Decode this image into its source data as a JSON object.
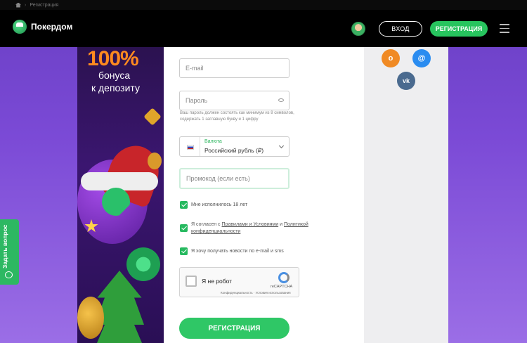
{
  "breadcrumb": {
    "current": "Регистрация"
  },
  "header": {
    "brand": "Покердом",
    "login_label": "ВХОД",
    "register_label": "РЕГИСТРАЦИЯ"
  },
  "banner": {
    "headline": "100%",
    "line1": "бонуса",
    "line2": "к депозиту"
  },
  "form": {
    "email_placeholder": "E-mail",
    "password_placeholder": "Пароль",
    "password_hint": "Ваш пароль должен состоять как минимум из 8 символов, содержать 1 заглавную букву и 1 цифру",
    "currency_label": "Валюта",
    "currency_value": "Российский рубль (₽)",
    "promo_placeholder": "Промокод (если есть)",
    "age_check": "Мне исполнилось 18 лет",
    "agree_prefix": "Я согласен с",
    "agree_terms": "Правилами и Условиями",
    "agree_and": "и",
    "agree_privacy_a": "Политикой",
    "agree_privacy_b": "конфиденциальности",
    "news_check": "Я хочу получать новости по e-mail и sms",
    "captcha_label": "Я не робот",
    "captcha_brand": "reCAPTCHA",
    "captcha_links": "Конфиденциальность · Условия использования",
    "submit_label": "РЕГИСТРАЦИЯ"
  },
  "social": {
    "ok": "о",
    "mail": "@",
    "vk": "vk"
  },
  "side_tab": {
    "label": "Задать вопрос"
  },
  "colors": {
    "accent": "#27c45e",
    "header_bg": "#000000",
    "background": "#7b4ad6"
  }
}
